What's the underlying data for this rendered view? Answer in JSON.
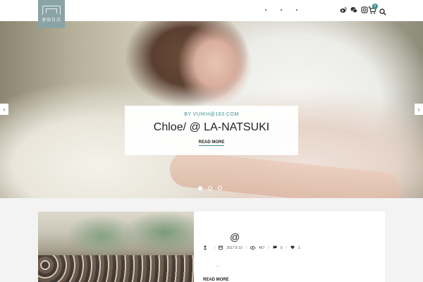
{
  "header": {
    "logo_text": "速骑日志",
    "nav_items": [
      "",
      "",
      ""
    ],
    "icons": [
      "weibo-icon",
      "wechat-icon",
      "instagram-icon"
    ],
    "cart_count": "0"
  },
  "hero": {
    "byline": "BY VUIKH@163.COM",
    "title": "Chloe/ @ LA-NATSUKI",
    "button_label": "READ MORE",
    "slide_count": 3,
    "active_slide": 1
  },
  "post": {
    "title": "@",
    "meta": {
      "author": "",
      "date": "2017 8 10",
      "views": "467",
      "comments": "0",
      "likes": "1"
    },
    "excerpt": "...",
    "read_more": "READ MORE"
  },
  "colors": {
    "accent": "#3a8f8f",
    "logo_bg": "#8aa3a5"
  }
}
